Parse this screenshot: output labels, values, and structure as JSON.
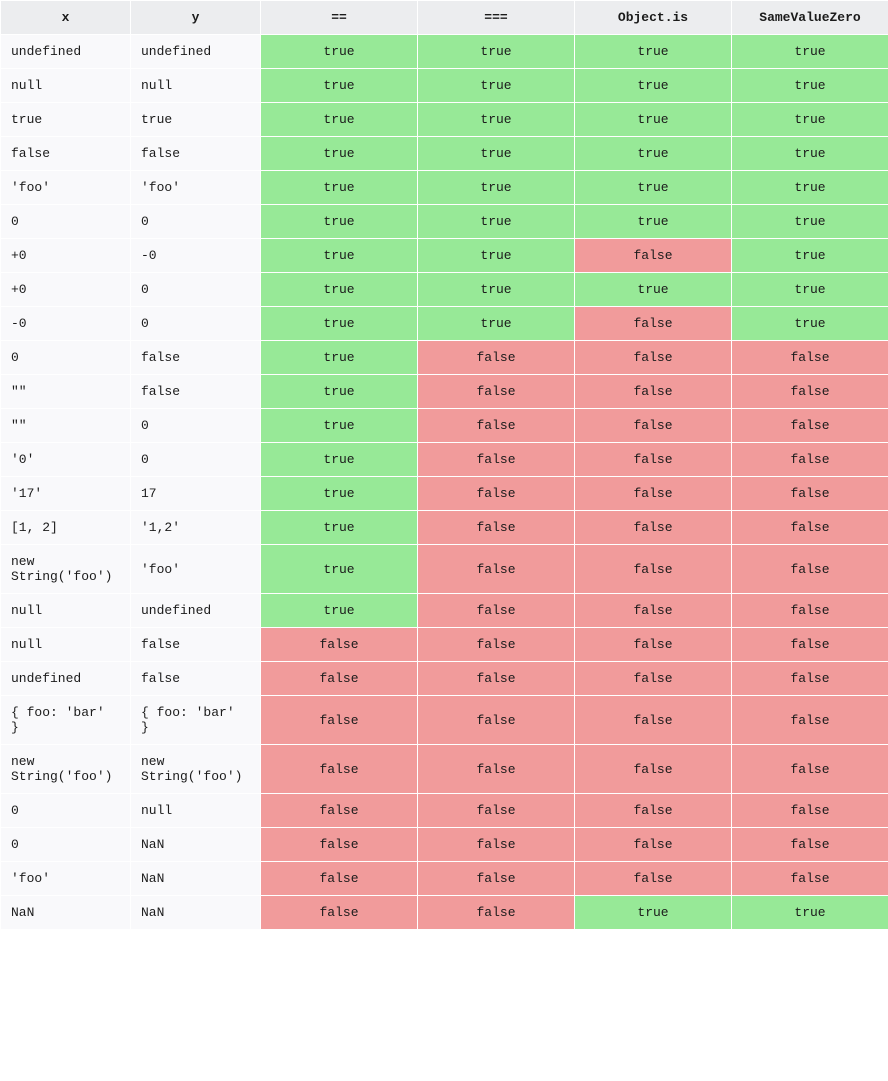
{
  "headers": [
    "x",
    "y",
    "==",
    "===",
    "Object.is",
    "SameValueZero"
  ],
  "rows": [
    {
      "x": "undefined",
      "y": "undefined",
      "eq": "true",
      "seq": "true",
      "ois": "true",
      "svz": "true"
    },
    {
      "x": "null",
      "y": "null",
      "eq": "true",
      "seq": "true",
      "ois": "true",
      "svz": "true"
    },
    {
      "x": "true",
      "y": "true",
      "eq": "true",
      "seq": "true",
      "ois": "true",
      "svz": "true"
    },
    {
      "x": "false",
      "y": "false",
      "eq": "true",
      "seq": "true",
      "ois": "true",
      "svz": "true"
    },
    {
      "x": "'foo'",
      "y": "'foo'",
      "eq": "true",
      "seq": "true",
      "ois": "true",
      "svz": "true"
    },
    {
      "x": "0",
      "y": "0",
      "eq": "true",
      "seq": "true",
      "ois": "true",
      "svz": "true"
    },
    {
      "x": "+0",
      "y": "-0",
      "eq": "true",
      "seq": "true",
      "ois": "false",
      "svz": "true"
    },
    {
      "x": "+0",
      "y": "0",
      "eq": "true",
      "seq": "true",
      "ois": "true",
      "svz": "true"
    },
    {
      "x": "-0",
      "y": "0",
      "eq": "true",
      "seq": "true",
      "ois": "false",
      "svz": "true"
    },
    {
      "x": "0",
      "y": "false",
      "eq": "true",
      "seq": "false",
      "ois": "false",
      "svz": "false"
    },
    {
      "x": "\"\"",
      "y": "false",
      "eq": "true",
      "seq": "false",
      "ois": "false",
      "svz": "false"
    },
    {
      "x": "\"\"",
      "y": "0",
      "eq": "true",
      "seq": "false",
      "ois": "false",
      "svz": "false"
    },
    {
      "x": "'0'",
      "y": "0",
      "eq": "true",
      "seq": "false",
      "ois": "false",
      "svz": "false"
    },
    {
      "x": "'17'",
      "y": "17",
      "eq": "true",
      "seq": "false",
      "ois": "false",
      "svz": "false"
    },
    {
      "x": "[1, 2]",
      "y": "'1,2'",
      "eq": "true",
      "seq": "false",
      "ois": "false",
      "svz": "false"
    },
    {
      "x": "new String('foo')",
      "y": "'foo'",
      "eq": "true",
      "seq": "false",
      "ois": "false",
      "svz": "false"
    },
    {
      "x": "null",
      "y": "undefined",
      "eq": "true",
      "seq": "false",
      "ois": "false",
      "svz": "false"
    },
    {
      "x": "null",
      "y": "false",
      "eq": "false",
      "seq": "false",
      "ois": "false",
      "svz": "false"
    },
    {
      "x": "undefined",
      "y": "false",
      "eq": "false",
      "seq": "false",
      "ois": "false",
      "svz": "false"
    },
    {
      "x": "{ foo: 'bar' }",
      "y": "{ foo: 'bar' }",
      "eq": "false",
      "seq": "false",
      "ois": "false",
      "svz": "false"
    },
    {
      "x": "new String('foo')",
      "y": "new String('foo')",
      "eq": "false",
      "seq": "false",
      "ois": "false",
      "svz": "false"
    },
    {
      "x": "0",
      "y": "null",
      "eq": "false",
      "seq": "false",
      "ois": "false",
      "svz": "false"
    },
    {
      "x": "0",
      "y": "NaN",
      "eq": "false",
      "seq": "false",
      "ois": "false",
      "svz": "false"
    },
    {
      "x": "'foo'",
      "y": "NaN",
      "eq": "false",
      "seq": "false",
      "ois": "false",
      "svz": "false"
    },
    {
      "x": "NaN",
      "y": "NaN",
      "eq": "false",
      "seq": "false",
      "ois": "true",
      "svz": "true"
    }
  ]
}
